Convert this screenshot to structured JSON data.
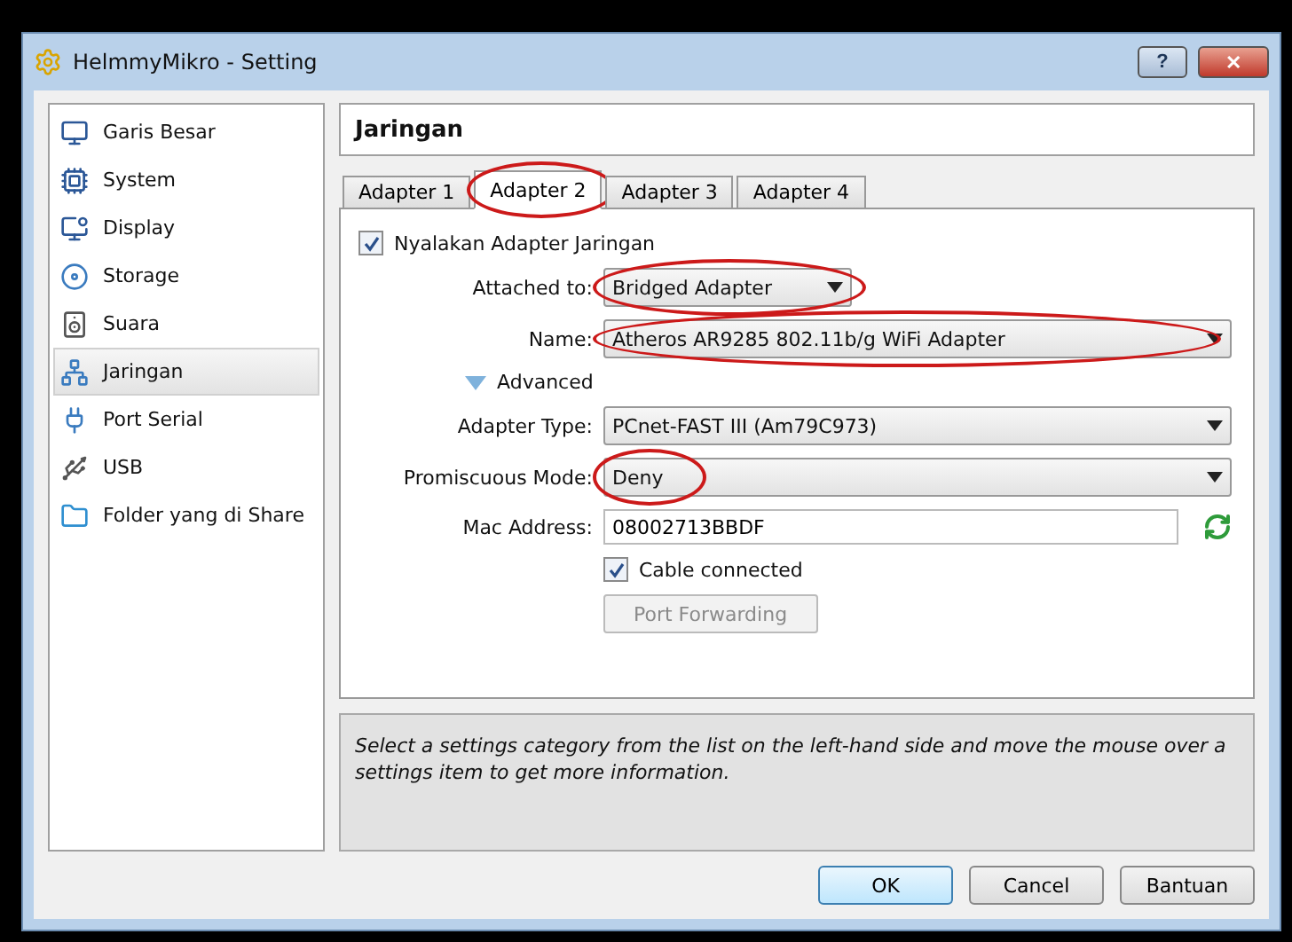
{
  "window": {
    "title": "HelmmyMikro - Setting",
    "buttons": [
      "?",
      "✕"
    ]
  },
  "sidebar": {
    "items": [
      {
        "label": "Garis Besar",
        "kind": "monitor",
        "selected": false
      },
      {
        "label": "System",
        "kind": "chip",
        "selected": false
      },
      {
        "label": "Display",
        "kind": "display",
        "selected": false
      },
      {
        "label": "Storage",
        "kind": "disc",
        "selected": false
      },
      {
        "label": "Suara",
        "kind": "speaker",
        "selected": false
      },
      {
        "label": "Jaringan",
        "kind": "network",
        "selected": true
      },
      {
        "label": "Port Serial",
        "kind": "plug",
        "selected": false
      },
      {
        "label": "USB",
        "kind": "usb",
        "selected": false
      },
      {
        "label": "Folder yang di Share",
        "kind": "folder",
        "selected": false
      }
    ]
  },
  "page_title": "Jaringan",
  "tabs": [
    {
      "label": "Adapter 1",
      "selected": false,
      "highlighted": false
    },
    {
      "label": "Adapter 2",
      "selected": true,
      "highlighted": true
    },
    {
      "label": "Adapter 3",
      "selected": false,
      "highlighted": false
    },
    {
      "label": "Adapter 4",
      "selected": false,
      "highlighted": false
    }
  ],
  "enable_adapter": {
    "label": "Nyalakan Adapter Jaringan",
    "checked": true
  },
  "attached_to": {
    "label": "Attached to:",
    "value": "Bridged Adapter",
    "highlighted": true
  },
  "name": {
    "label": "Name:",
    "value": "Atheros AR9285 802.11b/g WiFi Adapter",
    "highlighted": true
  },
  "advanced": {
    "label": "Advanced",
    "expanded": true
  },
  "adapter_type": {
    "label": "Adapter Type:",
    "value": "PCnet-FAST III (Am79C973)"
  },
  "promiscuous_mode": {
    "label": "Promiscuous Mode:",
    "value": "Deny",
    "highlighted": true
  },
  "mac_address": {
    "label": "Mac Address:",
    "value": "08002713BBDF"
  },
  "cable_connected": {
    "label": "Cable connected",
    "checked": true
  },
  "port_forwarding": {
    "label": "Port Forwarding",
    "disabled": true
  },
  "info": "Select a settings category from the list on the left-hand side and move the mouse over a settings item to get more information.",
  "footer_buttons": [
    {
      "label": "OK",
      "default": true
    },
    {
      "label": "Cancel",
      "default": false
    },
    {
      "label": "Bantuan",
      "default": false
    }
  ]
}
